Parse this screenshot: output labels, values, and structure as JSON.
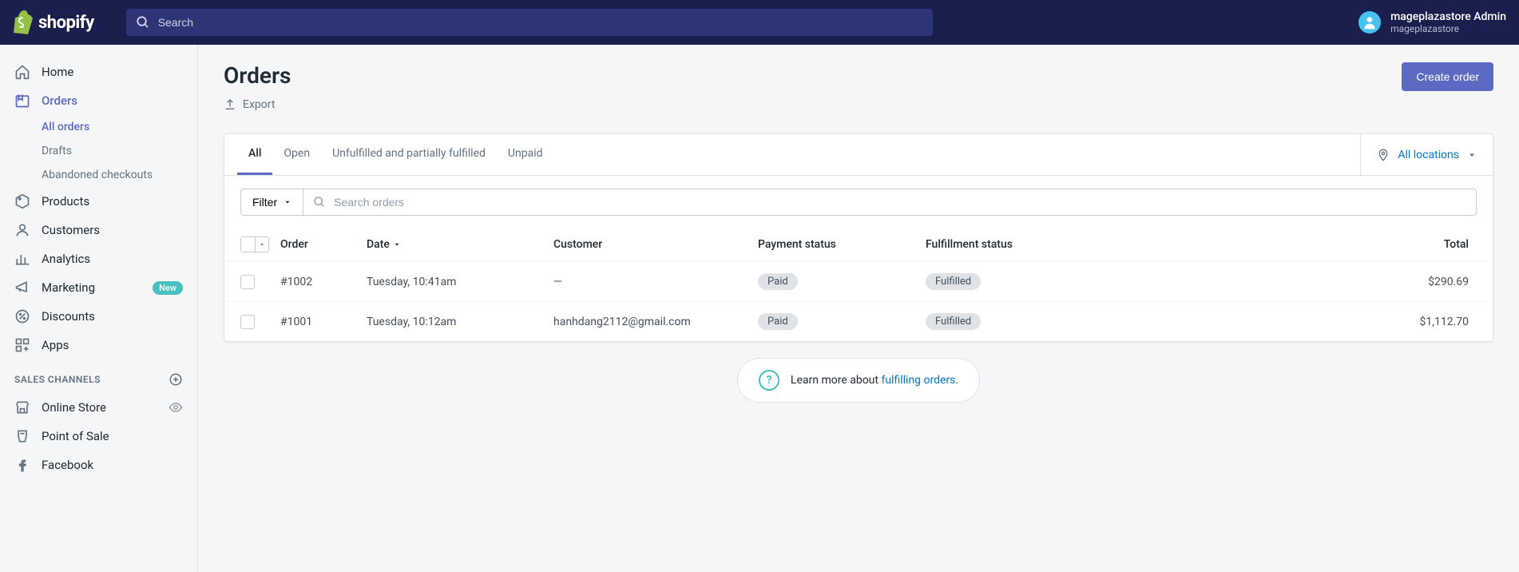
{
  "brand": "shopify",
  "search_placeholder": "Search",
  "user": {
    "name": "mageplazastore Admin",
    "store": "mageplazastore"
  },
  "sidebar": {
    "items": [
      {
        "label": "Home"
      },
      {
        "label": "Orders"
      },
      {
        "label": "Products"
      },
      {
        "label": "Customers"
      },
      {
        "label": "Analytics"
      },
      {
        "label": "Marketing",
        "badge": "New"
      },
      {
        "label": "Discounts"
      },
      {
        "label": "Apps"
      }
    ],
    "orders_sub": [
      {
        "label": "All orders"
      },
      {
        "label": "Drafts"
      },
      {
        "label": "Abandoned checkouts"
      }
    ],
    "channels_heading": "SALES CHANNELS",
    "channels": [
      {
        "label": "Online Store"
      },
      {
        "label": "Point of Sale"
      },
      {
        "label": "Facebook"
      }
    ]
  },
  "page": {
    "title": "Orders",
    "export": "Export",
    "create": "Create order"
  },
  "tabs": [
    {
      "label": "All"
    },
    {
      "label": "Open"
    },
    {
      "label": "Unfulfilled and partially fulfilled"
    },
    {
      "label": "Unpaid"
    }
  ],
  "locations_label": "All locations",
  "filter_label": "Filter",
  "search_orders_placeholder": "Search orders",
  "columns": {
    "order": "Order",
    "date": "Date",
    "customer": "Customer",
    "payment": "Payment status",
    "fulfillment": "Fulfillment status",
    "total": "Total"
  },
  "rows": [
    {
      "order": "#1002",
      "date": "Tuesday, 10:41am",
      "customer": "—",
      "payment": "Paid",
      "fulfillment": "Fulfilled",
      "total": "$290.69"
    },
    {
      "order": "#1001",
      "date": "Tuesday, 10:12am",
      "customer": "hanhdang2112@gmail.com",
      "payment": "Paid",
      "fulfillment": "Fulfilled",
      "total": "$1,112.70"
    }
  ],
  "help": {
    "prefix": "Learn more about ",
    "link": "fulfilling orders",
    "suffix": "."
  }
}
